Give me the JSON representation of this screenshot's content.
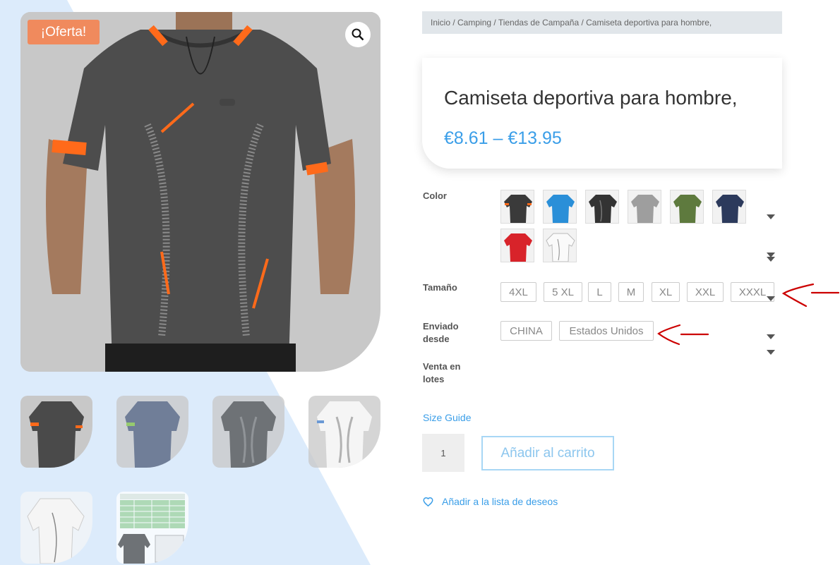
{
  "product": {
    "sale_badge": "¡Oferta!",
    "title": "Camiseta deportiva para hombre,",
    "price": "€8.61 – €13.95"
  },
  "breadcrumb": "Inicio / Camping / Tiendas de Campaña / Camiseta deportiva para hombre,",
  "attributes": {
    "color_label": "Color",
    "size_label": "Tamaño",
    "shipped_label_1": "Enviado",
    "shipped_label_2": "desde",
    "bulk_label_1": "Venta en",
    "bulk_label_2": "lotes",
    "color_swatches": [
      "black-orange",
      "blue",
      "black",
      "gray",
      "green",
      "navy",
      "red",
      "white"
    ],
    "sizes": [
      "4XL",
      "5 XL",
      "L",
      "M",
      "XL",
      "XXL",
      "XXXL"
    ],
    "ship_from": [
      "CHINA",
      "Estados Unidos"
    ]
  },
  "size_guide": "Size Guide",
  "quantity": "1",
  "add_to_cart": "Añadir al carrito",
  "wishlist": "Añadir a la lista de deseos",
  "colors": {
    "accent": "#3a9ee8",
    "badge": "#f08a5d",
    "annotation": "#cc0000"
  }
}
